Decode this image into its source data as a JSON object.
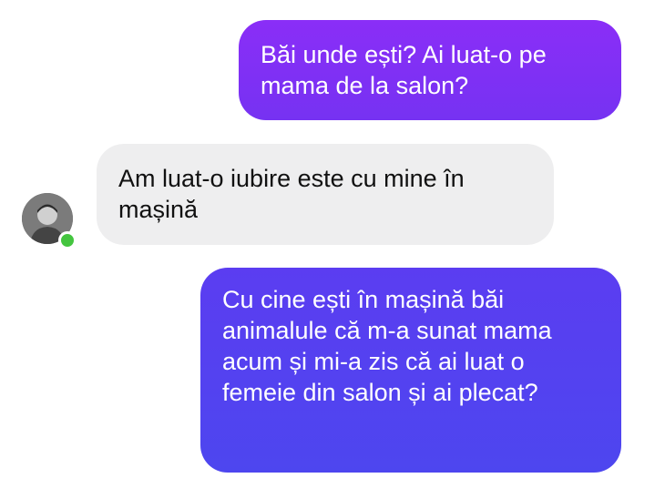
{
  "messages": [
    {
      "direction": "outgoing",
      "text": "Băi unde ești? Ai luat-o pe mama de la salon?"
    },
    {
      "direction": "incoming",
      "text": "Am luat-o iubire este cu mine în mașină"
    },
    {
      "direction": "outgoing",
      "text": "Cu cine ești în mașină băi animalule că m-a sunat mama acum și mi-a zis că ai luat o femeie din salon și ai plecat?"
    }
  ],
  "contact": {
    "avatar_icon": "user-avatar-photo",
    "status": "online",
    "status_color": "#44c53f"
  },
  "colors": {
    "outgoing_top": "#8a2ef7",
    "outgoing_bottom": "#4d46ef",
    "incoming_bg": "#eeeeef",
    "incoming_text": "#111111"
  }
}
